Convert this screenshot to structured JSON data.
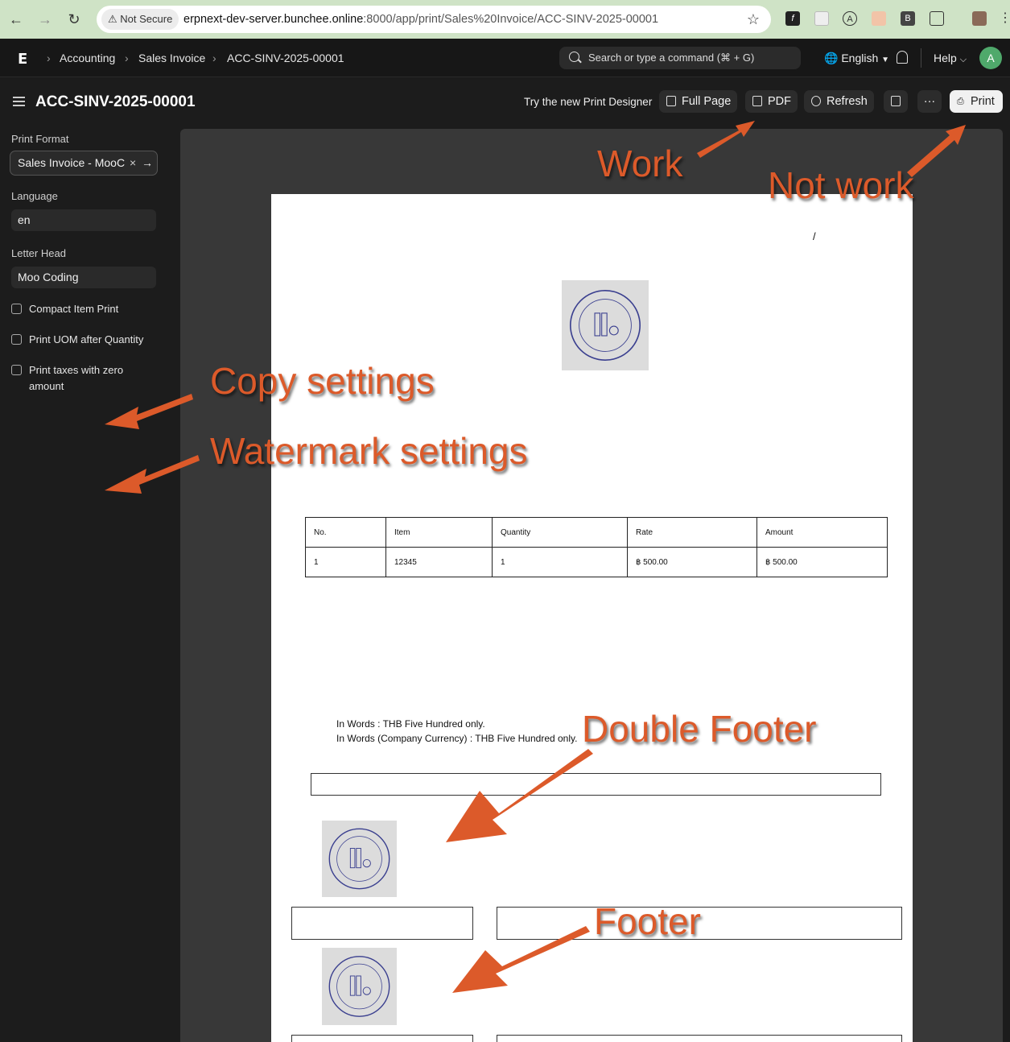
{
  "browser": {
    "security_label": "Not Secure",
    "url_host": "erpnext-dev-server.bunchee.online",
    "url_path": ":8000/app/print/Sales%20Invoice/ACC-SINV-2025-00001"
  },
  "appbar": {
    "logo": "E",
    "breadcrumbs": [
      "Accounting",
      "Sales Invoice",
      "ACC-SINV-2025-00001"
    ],
    "search_placeholder": "Search or type a command (⌘ + G)",
    "language": "English",
    "help": "Help",
    "avatar_initial": "A"
  },
  "page": {
    "title": "ACC-SINV-2025-00001",
    "try_designer": "Try the new Print Designer",
    "buttons": {
      "full_page": "Full Page",
      "pdf": "PDF",
      "refresh": "Refresh",
      "more": "···",
      "print": "Print"
    }
  },
  "sidebar": {
    "print_format_label": "Print Format",
    "print_format_value": "Sales Invoice - MooC",
    "language_label": "Language",
    "language_value": "en",
    "letter_head_label": "Letter Head",
    "letter_head_value": "Moo Coding",
    "checkboxes": [
      {
        "label": "Compact Item Print",
        "checked": false
      },
      {
        "label": "Print UOM after Quantity",
        "checked": false
      },
      {
        "label": "Print taxes with zero amount",
        "checked": false
      }
    ]
  },
  "document": {
    "slash": "/",
    "table": {
      "headers": [
        "No.",
        "Item",
        "Quantity",
        "Rate",
        "Amount"
      ],
      "rows": [
        [
          "1",
          "12345",
          "1",
          "฿ 500.00",
          "฿ 500.00"
        ]
      ]
    },
    "in_words_label": "In Words :",
    "in_words_value": "THB Five Hundred only.",
    "in_words_company_label": "In Words (Company Currency) :",
    "in_words_company_value": "THB Five Hundred only."
  },
  "annotations": {
    "work": "Work",
    "not_work": "Not work",
    "copy_settings": "Copy settings",
    "watermark_settings": "Watermark settings",
    "double_footer": "Double Footer",
    "footer": "Footer",
    "color": "#dc5a2a"
  }
}
